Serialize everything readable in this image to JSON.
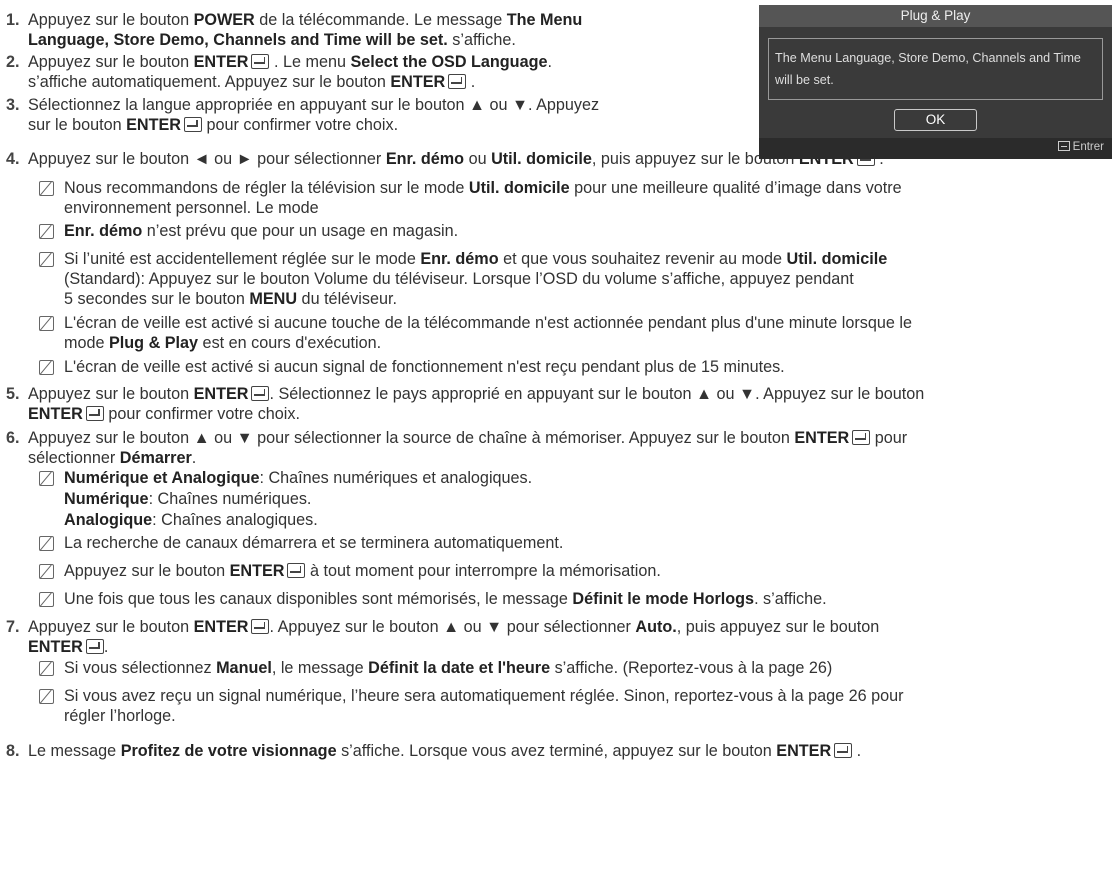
{
  "steps": {
    "s1": {
      "num": "1.",
      "p1": "Appuyez sur le bouton ",
      "b1": "POWER",
      "p2": " de la télécommande. Le message ",
      "b2": "The Menu",
      "b3": "Language, Store Demo, Channels and Time will be set.",
      "p3": " s’affiche."
    },
    "s2": {
      "num": "2.",
      "p1": "Appuyez sur le bouton ",
      "b1": "ENTER",
      "p2": " . Le menu ",
      "b2": "Select the OSD Language",
      "p3": ".",
      "p4": "s’affiche automatiquement. Appuyez sur le bouton ",
      "b3": "ENTER",
      "p5": " ."
    },
    "s3": {
      "num": "3.",
      "p1": "Sélectionnez la langue appropriée en appuyant sur le bouton ▲ ou ▼. Appuyez",
      "p2": "sur le bouton ",
      "b1": "ENTER",
      "p3": " pour confirmer votre choix."
    },
    "s4": {
      "num": "4.",
      "p1": "Appuyez sur le bouton ◄ ou ► pour sélectionner ",
      "b1": "Enr. démo",
      "p2": " ou ",
      "b2": "Util. domicile",
      "p3": ", puis appuyez sur le bouton ",
      "b3": "ENTER",
      "p4": " ."
    },
    "s4n1": {
      "p1": "Nous recommandons de régler la télévision sur le mode ",
      "b1": "Util. domicile",
      "p2": " pour une meilleure qualité d’image dans votre",
      "p3": "environnement personnel. Le mode"
    },
    "s4n2": {
      "b1": "Enr. démo",
      "p1": " n’est prévu que pour un usage en magasin."
    },
    "s4n3": {
      "p1": "Si l’unité est accidentellement réglée sur le mode ",
      "b1": "Enr. démo",
      "p2": " et que vous souhaitez revenir au mode ",
      "b2": "Util. domicile",
      "p3": "(Standard): Appuyez sur le bouton Volume du téléviseur. Lorsque l’OSD du volume s’affiche, appuyez pendant",
      "p4": "5 secondes sur le bouton ",
      "b3": "MENU",
      "p5": " du téléviseur."
    },
    "s4n4": {
      "p1": "L'écran de veille est activé si aucune touche de la télécommande n'est actionnée pendant plus d'une minute lorsque le",
      "p2": "mode ",
      "b1": "Plug & Play",
      "p3": " est en cours d'exécution."
    },
    "s4n5": {
      "p1": "L'écran de veille est activé si aucun signal de fonctionnement n'est reçu pendant plus de 15 minutes."
    },
    "s5": {
      "num": "5.",
      "p1": "Appuyez sur le bouton ",
      "b1": "ENTER",
      "p2": ". Sélectionnez le pays approprié en appuyant sur le bouton ▲ ou ▼. Appuyez sur le bouton",
      "b2": "ENTER",
      "p3": " pour confirmer votre choix."
    },
    "s6": {
      "num": "6.",
      "p1": "Appuyez sur le bouton ▲ ou ▼ pour sélectionner la source de chaîne à mémoriser. Appuyez sur le bouton ",
      "b1": "ENTER",
      "p2": "  pour",
      "p3": "sélectionner ",
      "b2": "Démarrer",
      "p4": "."
    },
    "s6n1": {
      "b1": "Numérique et Analogique",
      "p1": ": Chaînes numériques et analogiques.",
      "b2": "Numérique",
      "p2": ": Chaînes numériques.",
      "b3": "Analogique",
      "p3": ": Chaînes analogiques."
    },
    "s6n2": {
      "p1": "La recherche de canaux démarrera et se terminera automatiquement."
    },
    "s6n3": {
      "p1": "Appuyez sur le bouton ",
      "b1": "ENTER",
      "p2": "  à tout moment pour interrompre la mémorisation."
    },
    "s6n4": {
      "p1": "Une fois que tous les canaux disponibles sont mémorisés, le message ",
      "b1": "Définit le mode Horlogs",
      "p2": ". s’affiche."
    },
    "s7": {
      "num": "7.",
      "p1": "Appuyez sur le bouton ",
      "b1": "ENTER",
      "p2": ". Appuyez sur le bouton ▲ ou ▼ pour sélectionner ",
      "b2": "Auto.",
      "p3": ", puis appuyez sur le bouton",
      "b3": "ENTER",
      "p4": "."
    },
    "s7n1": {
      "p1": "Si vous sélectionnez ",
      "b1": "Manuel",
      "p2": ", le message ",
      "b2": "Définit la date et l'heure",
      "p3": " s’affiche. (Reportez-vous à la page 26)"
    },
    "s7n2": {
      "p1": "Si vous avez reçu un signal numérique, l’heure sera automatiquement réglée. Sinon, reportez-vous à la page 26 pour",
      "p2": "régler l’horloge."
    },
    "s8": {
      "num": "8.",
      "p1": "Le message ",
      "b1": "Profitez de votre visionnage",
      "p2": " s’affiche. Lorsque vous avez terminé, appuyez sur le bouton ",
      "b2": "ENTER",
      "p3": " ."
    }
  },
  "dialog": {
    "title": "Plug & Play",
    "message_line1": "The Menu Language, Store Demo, Channels and Time",
    "message_line2": "will be set.",
    "ok_label": "OK",
    "footer_label": "Entrer"
  }
}
